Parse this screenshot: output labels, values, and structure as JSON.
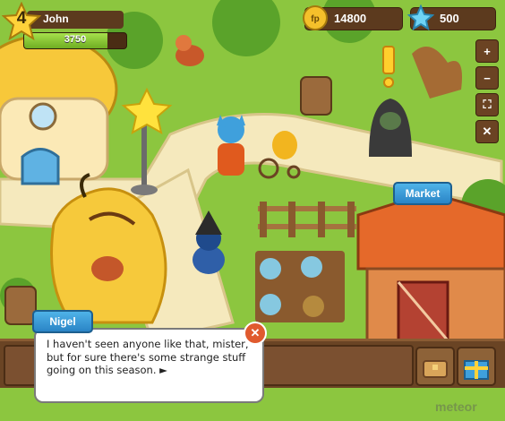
{
  "player": {
    "level": "4",
    "name": "John",
    "xp": "3750",
    "xp_fraction": 0.82
  },
  "currency": {
    "coins": "14800",
    "gems": "500",
    "coin_badge": "fp"
  },
  "toolbar": {
    "zoom_in": "+",
    "zoom_out": "−",
    "fullscreen": "⛶",
    "settings": "✕"
  },
  "locations": {
    "market": "Market"
  },
  "dialog": {
    "speaker": "Nigel",
    "text": "I haven't seen anyone like that, mister, but for sure there's some strange stuff going on this season. ►",
    "close": "✕"
  },
  "watermark": "meteor",
  "colors": {
    "grass": "#8cc63f",
    "path": "#f3e6b4",
    "wood": "#6a4424",
    "accent_blue": "#2a84c6"
  },
  "icons": [
    "level-star-icon",
    "coin-icon",
    "gem-icon",
    "zoom-in-icon",
    "zoom-out-icon",
    "fullscreen-icon",
    "settings-icon",
    "close-icon",
    "chest-icon",
    "gift-icon"
  ]
}
